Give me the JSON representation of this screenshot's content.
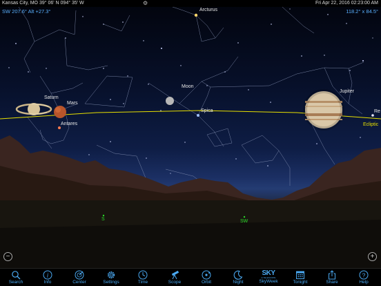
{
  "status_bar": {
    "location": "Kansas City, MO   39° 06' N 094° 35' W",
    "datetime": "Fri Apr 22, 2016   02:23:00 AM"
  },
  "readouts": {
    "left": "SW 207.6° Alt +27.3°",
    "right": "118.2° x 84.5°"
  },
  "objects": {
    "saturn": "Saturn",
    "mars": "Mars",
    "antares": "Antares",
    "moon": "Moon",
    "spica": "Spica",
    "arcturus": "Arcturus",
    "jupiter": "Jupiter",
    "regulus_partial": "Re"
  },
  "ecliptic_label": "Ecliptic",
  "cardinals": {
    "s": "S",
    "sw": "SW"
  },
  "zoom": {
    "out": "−",
    "in": "+"
  },
  "toolbar": [
    {
      "label": "Search",
      "icon": "search-icon"
    },
    {
      "label": "Info",
      "icon": "info-icon"
    },
    {
      "label": "Center",
      "icon": "center-icon"
    },
    {
      "label": "Settings",
      "icon": "gear-icon"
    },
    {
      "label": "Time",
      "icon": "clock-icon"
    },
    {
      "label": "Scope",
      "icon": "telescope-icon"
    },
    {
      "label": "Orbit",
      "icon": "orbit-icon"
    },
    {
      "label": "Night",
      "icon": "moon-icon"
    },
    {
      "label": "SkyWeek",
      "icon": "skyweek-logo-icon"
    },
    {
      "label": "Tonight",
      "icon": "calendar-icon"
    },
    {
      "label": "Share",
      "icon": "share-icon"
    },
    {
      "label": "Help",
      "icon": "help-icon"
    }
  ],
  "skyweek_logo": {
    "big": "SKY",
    "small": "& TELESCOPE"
  },
  "colors": {
    "accent": "#4aa8f0",
    "ecliptic": "#e8e000",
    "cardinal": "#29d829",
    "constellation_lines": "#8a96b8"
  }
}
